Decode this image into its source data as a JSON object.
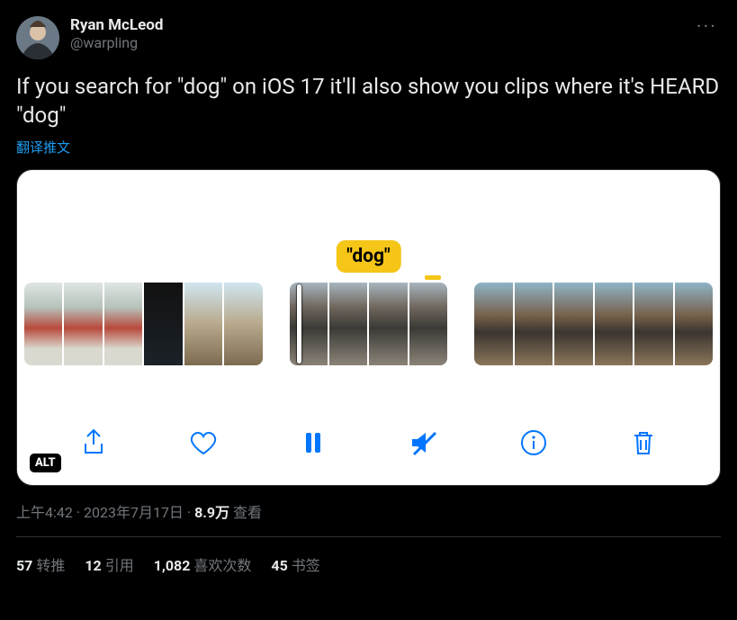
{
  "author": {
    "display_name": "Ryan McLeod",
    "handle": "@warpling"
  },
  "tweet_text": "If you search for \"dog\" on iOS 17 it'll also show you clips where it's HEARD \"dog\"",
  "translate_label": "翻译推文",
  "media": {
    "caption_text": "\"dog\"",
    "alt_badge": "ALT"
  },
  "meta": {
    "time": "上午4:42",
    "separator": " · ",
    "date": "2023年7月17日",
    "views_strong": "8.9万",
    "views_label": " 查看"
  },
  "stats": {
    "retweets": {
      "count": "57",
      "label": "转推"
    },
    "quotes": {
      "count": "12",
      "label": "引用"
    },
    "likes": {
      "count": "1,082",
      "label": "喜欢次数"
    },
    "bookmarks": {
      "count": "45",
      "label": "书签"
    }
  }
}
